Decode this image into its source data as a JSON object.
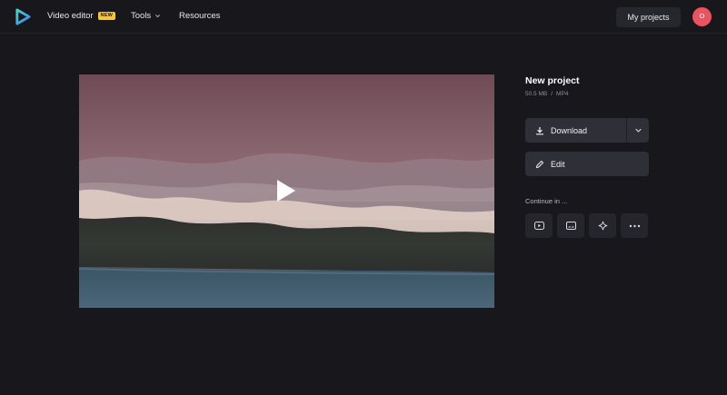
{
  "header": {
    "video_editor_label": "Video editor",
    "new_badge": "NEW",
    "tools_label": "Tools",
    "resources_label": "Resources",
    "my_projects_label": "My projects",
    "avatar_initial": "O"
  },
  "project": {
    "title": "New project",
    "size": "50.5 MB",
    "separator": "/",
    "format": "MP4"
  },
  "actions": {
    "download_label": "Download",
    "edit_label": "Edit",
    "continue_label": "Continue in ..."
  },
  "continue_icons": [
    "youtube-icon",
    "subtitles-icon",
    "sparkle-icon",
    "more-icon"
  ],
  "colors": {
    "background": "#17171c",
    "button": "#2f2f37",
    "avatar": "#e8545f",
    "badge": "#f5c542",
    "logo_accent": "#3ec1d3"
  }
}
